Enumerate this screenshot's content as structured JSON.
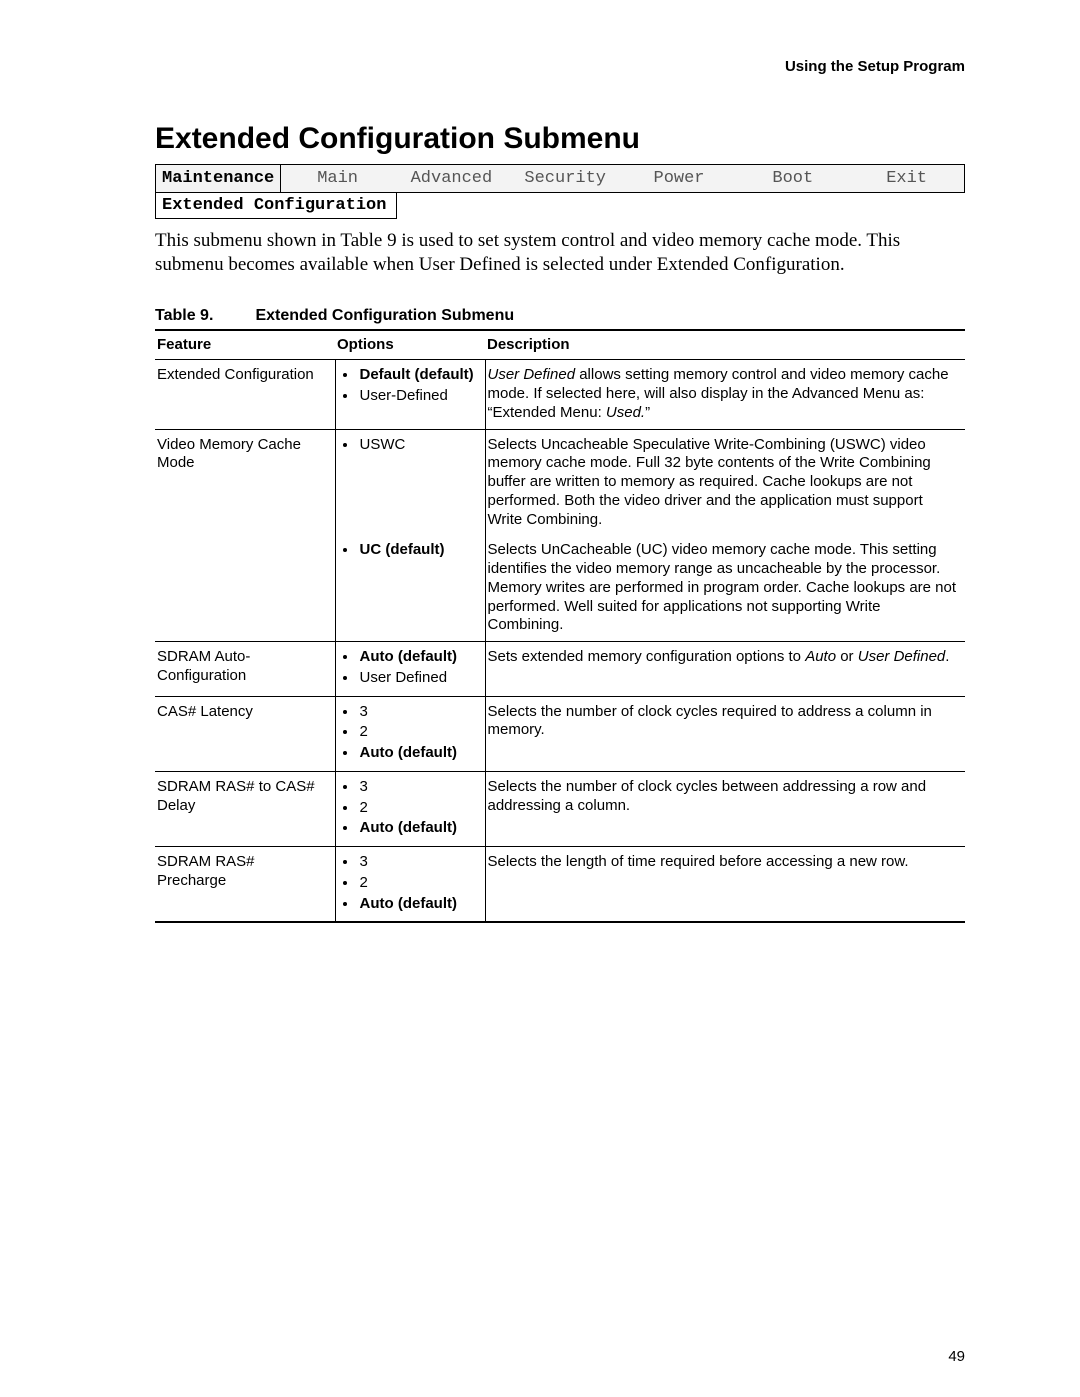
{
  "running_header": "Using the Setup Program",
  "section_title": "Extended Configuration Submenu",
  "bios_tabs": {
    "items": [
      "Maintenance",
      "Main",
      "Advanced",
      "Security",
      "Power",
      "Boot",
      "Exit"
    ],
    "active_index": 0,
    "subtab": "Extended Configuration"
  },
  "intro_html": "This submenu shown in Table 9 is used to set system control and video memory cache mode.  This submenu becomes available when User Defined is selected under Extended Configuration.",
  "table": {
    "caption_label": "Table 9.",
    "caption_title": "Extended Configuration Submenu",
    "headers": [
      "Feature",
      "Options",
      "Description"
    ],
    "rows": [
      {
        "feature": "Extended Configuration",
        "options": [
          {
            "text": "Default (default)",
            "bold": true
          },
          {
            "text": "User-Defined",
            "bold": false
          }
        ],
        "description_html": "<span class=\"italic\">User Defined</span> allows setting memory control and video memory cache mode.  If selected here, will also display in the Advanced Menu as:  “Extended Menu:  <span class=\"italic\">Used.</span>”"
      },
      {
        "feature": "Video Memory Cache Mode",
        "options": [
          {
            "text": "USWC",
            "bold": false
          }
        ],
        "description_html": "Selects Uncacheable Speculative Write-Combining (USWC) video memory cache mode.  Full 32 byte contents of the Write Combining buffer are written to memory as required.  Cache lookups are not performed.  Both the video driver and the application must support Write Combining."
      },
      {
        "feature": "",
        "continuation": true,
        "options": [
          {
            "text": "UC (default)",
            "bold": true
          }
        ],
        "description_html": "Selects UnCacheable (UC) video memory cache mode.  This setting identifies the video memory range as uncacheable by the processor.  Memory writes are performed in program order.  Cache lookups are not performed.  Well suited for applications not supporting Write Combining."
      },
      {
        "feature": "SDRAM Auto-Configuration",
        "options": [
          {
            "text": "Auto (default)",
            "bold": true
          },
          {
            "text": "User Defined",
            "bold": false
          }
        ],
        "description_html": "Sets extended memory configuration options to <span class=\"italic\">Auto</span> or <span class=\"italic\">User Defined</span>."
      },
      {
        "feature": "CAS# Latency",
        "options": [
          {
            "text": "3",
            "bold": false
          },
          {
            "text": "2",
            "bold": false
          },
          {
            "text": "Auto (default)",
            "bold": true
          }
        ],
        "description_html": "Selects the number of clock cycles required to address a column in memory."
      },
      {
        "feature": "SDRAM RAS# to CAS# Delay",
        "options": [
          {
            "text": "3",
            "bold": false
          },
          {
            "text": "2",
            "bold": false
          },
          {
            "text": "Auto (default)",
            "bold": true
          }
        ],
        "description_html": "Selects the number of clock cycles between addressing a row and addressing a column."
      },
      {
        "feature": "SDRAM RAS# Precharge",
        "options": [
          {
            "text": "3",
            "bold": false
          },
          {
            "text": "2",
            "bold": false
          },
          {
            "text": "Auto (default)",
            "bold": true
          }
        ],
        "description_html": "Selects the length of time required before accessing a new row."
      }
    ]
  },
  "page_number": "49"
}
